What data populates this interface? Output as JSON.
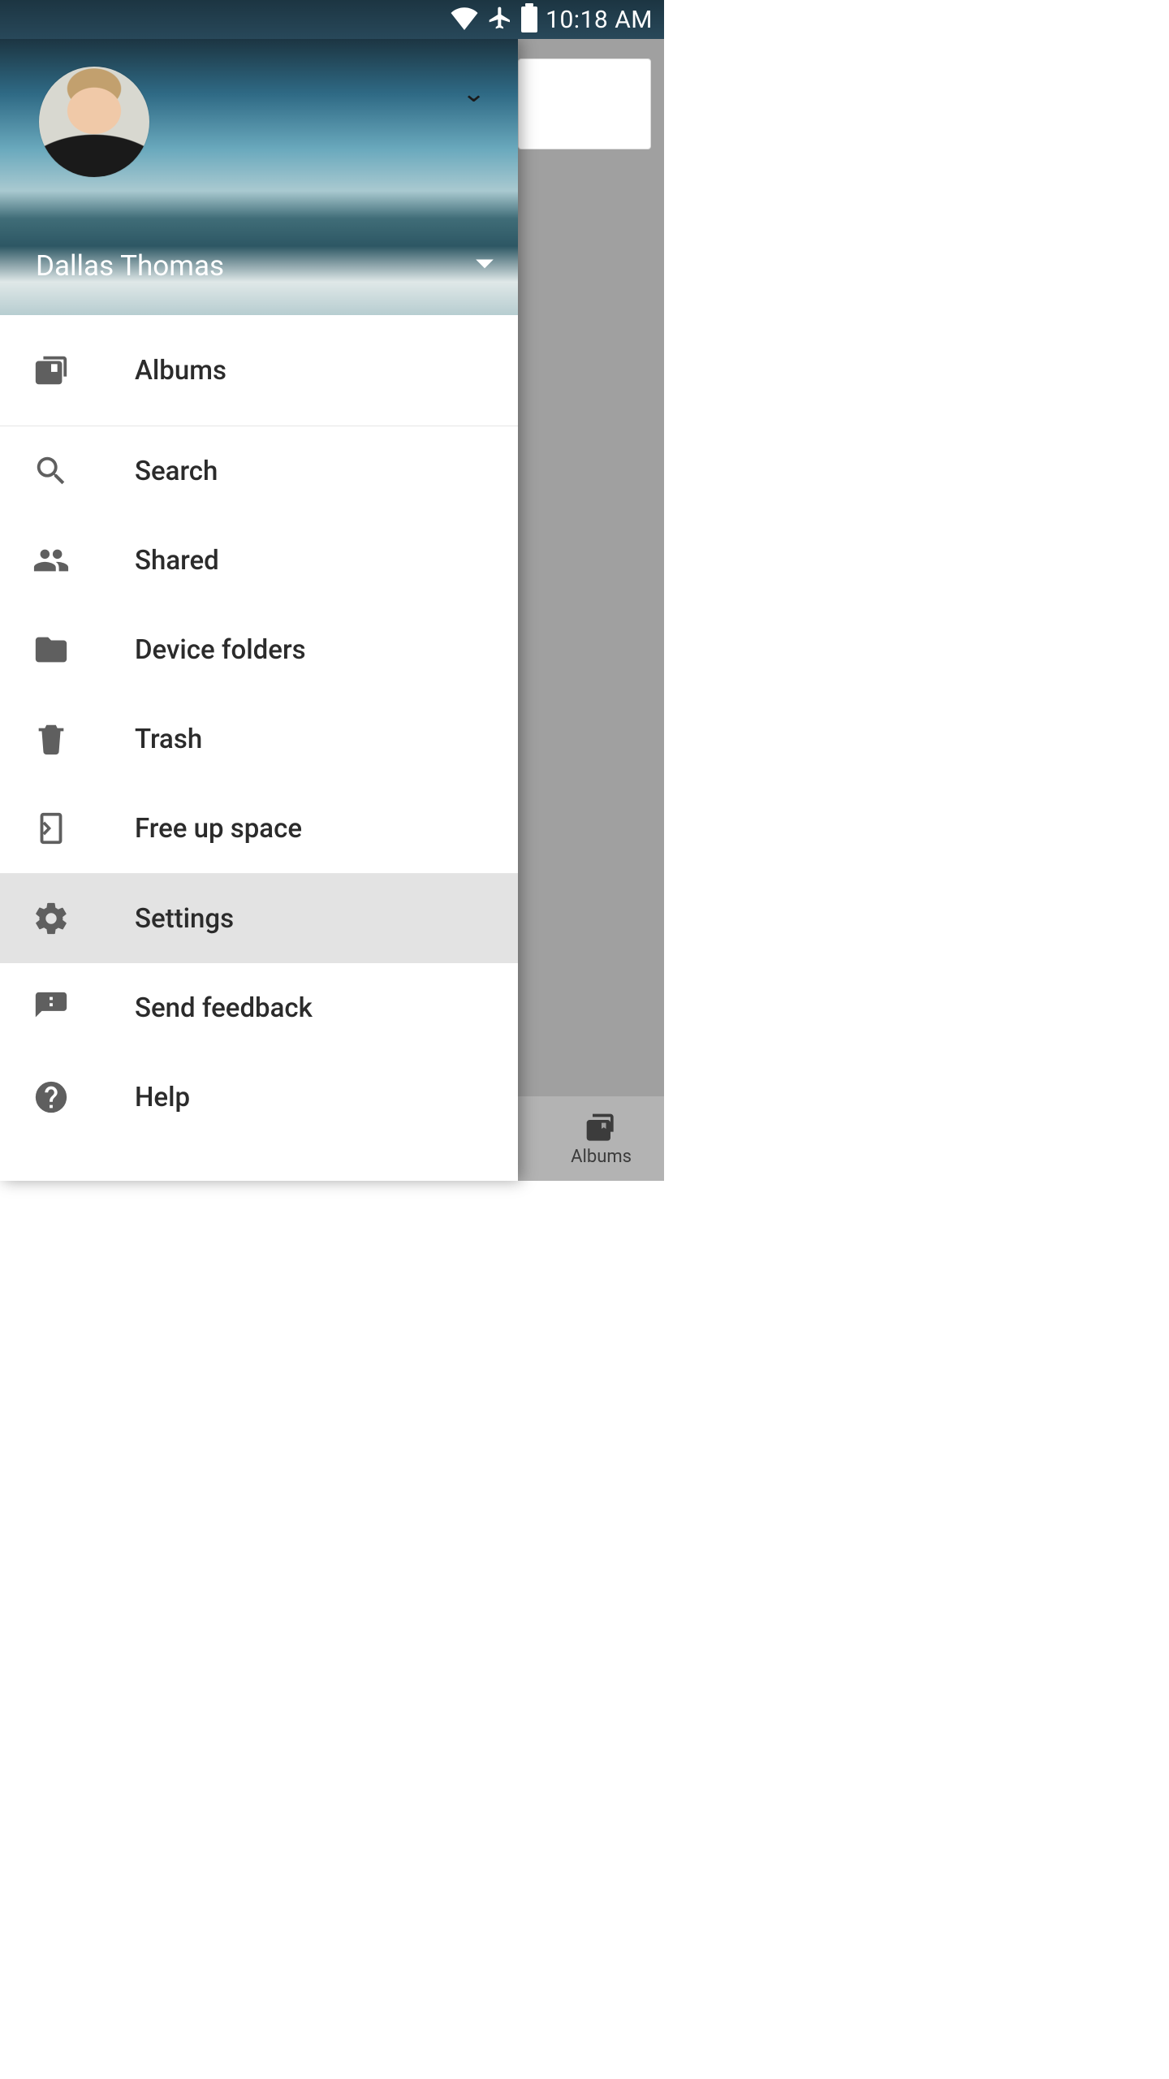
{
  "status_bar": {
    "time": "10:18 AM"
  },
  "account": {
    "name": "Dallas Thomas"
  },
  "drawer": {
    "items": {
      "albums": {
        "label": "Albums",
        "icon": "albums-icon"
      },
      "search": {
        "label": "Search",
        "icon": "search-icon"
      },
      "shared": {
        "label": "Shared",
        "icon": "people-icon"
      },
      "device_folders": {
        "label": "Device folders",
        "icon": "folder-icon"
      },
      "trash": {
        "label": "Trash",
        "icon": "trash-icon"
      },
      "free_up_space": {
        "label": "Free up space",
        "icon": "free-space-icon"
      },
      "settings": {
        "label": "Settings",
        "icon": "gear-icon"
      },
      "send_feedback": {
        "label": "Send feedback",
        "icon": "feedback-icon"
      },
      "help": {
        "label": "Help",
        "icon": "help-icon"
      }
    }
  },
  "bottom_nav": {
    "albums_label": "Albums"
  }
}
